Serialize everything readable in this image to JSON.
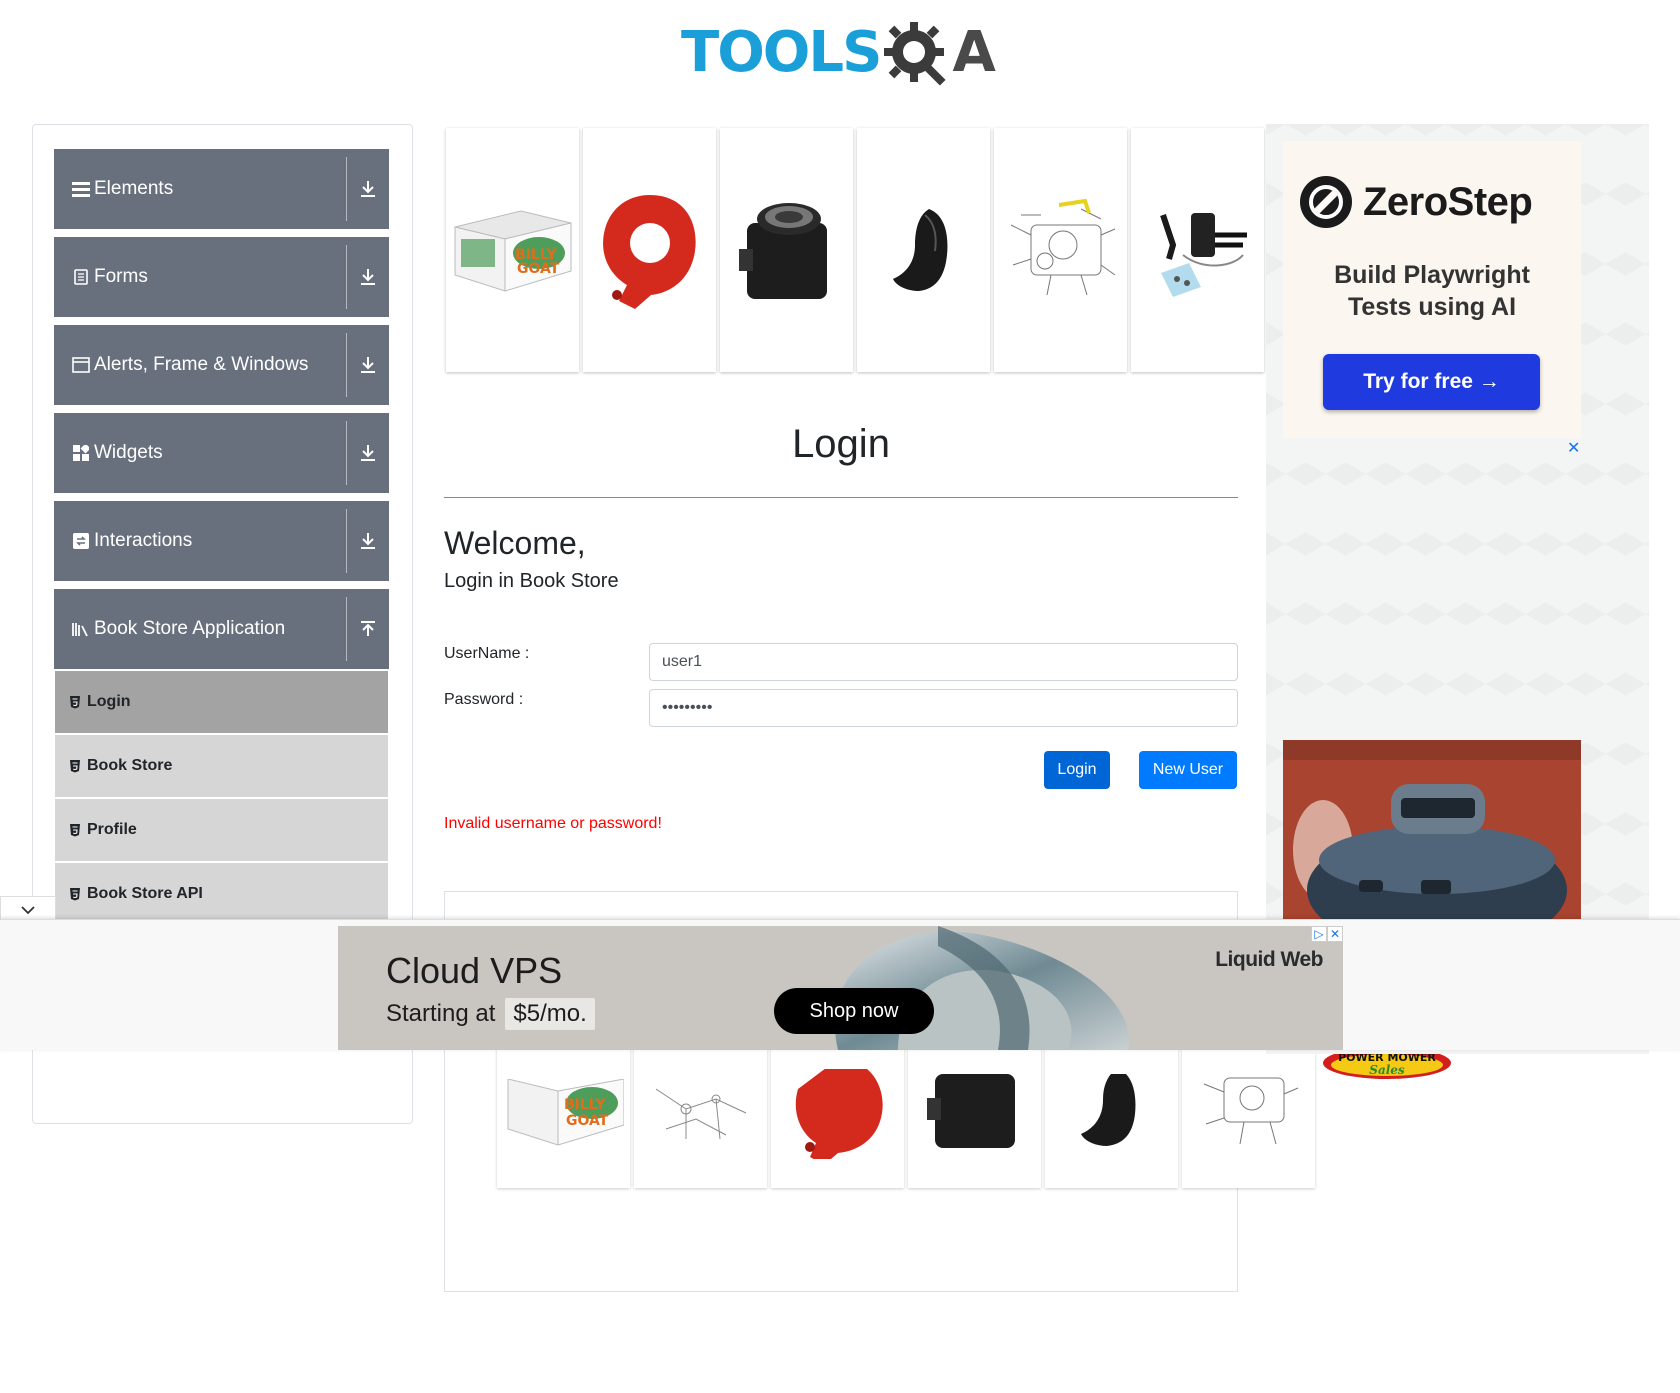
{
  "logo": {
    "tools": "TOOLS",
    "qa": "A"
  },
  "sidebar": {
    "groups": [
      {
        "label": "Elements",
        "icon": "menu-icon",
        "expanded": false
      },
      {
        "label": "Forms",
        "icon": "form-icon",
        "expanded": false
      },
      {
        "label": "Alerts, Frame & Windows",
        "icon": "window-icon",
        "expanded": false
      },
      {
        "label": "Widgets",
        "icon": "widgets-icon",
        "expanded": false
      },
      {
        "label": "Interactions",
        "icon": "interactions-icon",
        "expanded": false
      },
      {
        "label": "Book Store Application",
        "icon": "books-icon",
        "expanded": true
      }
    ],
    "book_store_items": [
      {
        "label": "Login",
        "active": true
      },
      {
        "label": "Book Store",
        "active": false
      },
      {
        "label": "Profile",
        "active": false
      },
      {
        "label": "Book Store API",
        "active": false
      }
    ]
  },
  "main": {
    "title": "Login",
    "welcome": "Welcome,",
    "subtitle": "Login in Book Store",
    "username_label": "UserName :",
    "username_value": "user1",
    "password_label": "Password :",
    "password_value": "•••••••••",
    "login_button": "Login",
    "new_user_button": "New User",
    "error": "Invalid username or password!"
  },
  "ads": {
    "zerostep": {
      "brand": "ZeroStep",
      "line1": "Build Playwright",
      "line2": "Tests using AI",
      "cta": "Try for free →"
    },
    "close_label": "✕",
    "banner": {
      "title": "Cloud VPS",
      "sub": "Starting at",
      "price": "$5/mo.",
      "cta": "Shop now",
      "brand": "Liquid Web"
    },
    "mower_logo": "POWER MOWER Sales"
  },
  "colors": {
    "sidebar_group": "#68707e",
    "sub_active": "#a3a3a3",
    "sub_inactive": "#d6d6d6",
    "login_btn": "#0066d6",
    "new_user_btn": "#007bff",
    "error": "#ff0000",
    "logo_blue": "#1a9fd9"
  }
}
